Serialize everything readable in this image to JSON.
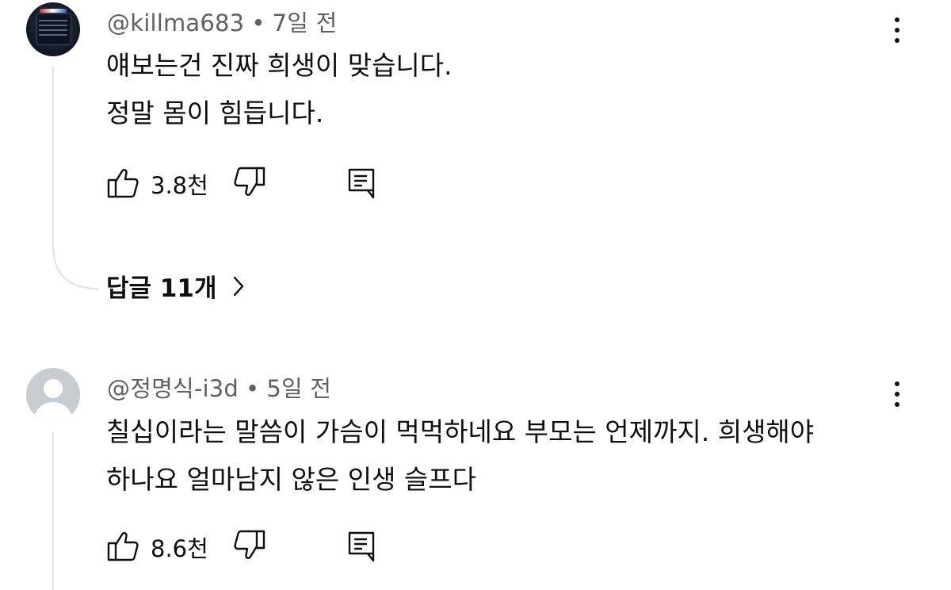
{
  "comments": [
    {
      "author": "@killma683",
      "time": "7일 전",
      "lines": [
        "얘보는건 진짜 희생이 맞습니다.",
        "정말 몸이 힘듭니다."
      ],
      "likes": "3.8천",
      "replies_label": "답글 11개"
    },
    {
      "author": "@정명식-i3d",
      "time": "5일 전",
      "lines": [
        "칠십이라는 말씀이 가슴이 먹먹하네요 부모는 언제까지. 희생해야",
        "하나요 얼마남지 않은 인생 슬프다"
      ],
      "likes": "8.6천"
    }
  ],
  "separator": "•",
  "icons": {
    "like": "thumbs-up-icon",
    "dislike": "thumbs-down-icon",
    "reply": "comment-icon",
    "more": "more-vert-icon",
    "expand": "chevron-right-icon"
  },
  "colors": {
    "text": "#0f0f0f",
    "secondary": "#606060",
    "thread_line": "#e2e2e2"
  }
}
